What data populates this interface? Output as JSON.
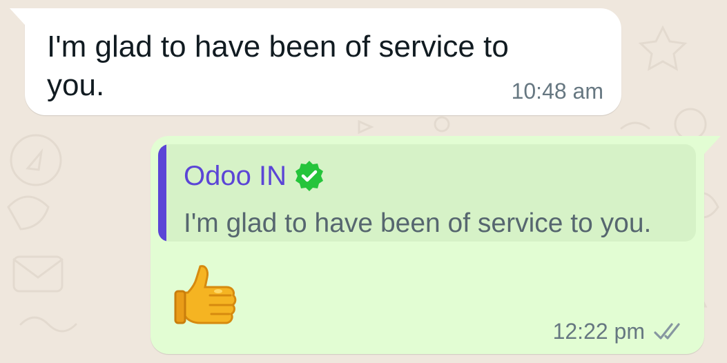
{
  "messages": {
    "incoming": {
      "text": "I'm glad to have been of service to you.",
      "time": "10:48 am"
    },
    "outgoing": {
      "quote": {
        "author": "Odoo IN",
        "text": "I'm glad to have been of service to you."
      },
      "emoji": "👍",
      "time": "12:22 pm",
      "status_icon": "double-check-icon"
    }
  },
  "colors": {
    "wallpaper": "#efe7dd",
    "incoming_bubble": "#ffffff",
    "outgoing_bubble": "#e2fdd3",
    "quote_background": "#d6f2c7",
    "quote_accent": "#5b45d6",
    "verified_badge": "#25c43b",
    "timestamp": "#667781"
  }
}
